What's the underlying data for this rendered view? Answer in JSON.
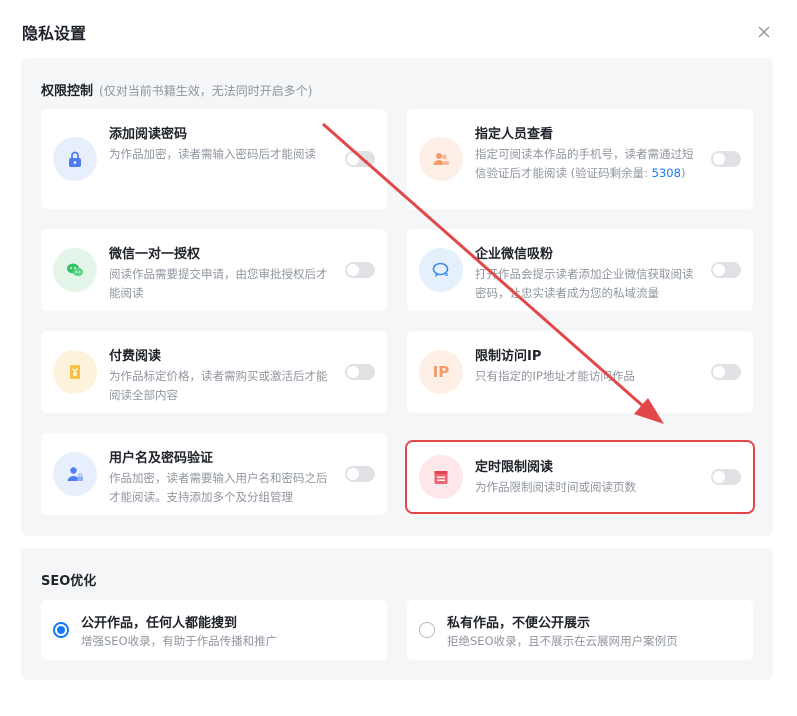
{
  "dialog": {
    "title": "隐私设置",
    "close_icon": "close-icon"
  },
  "permissions": {
    "title": "权限控制",
    "note": "(仅对当前书籍生效，无法同时开启多个)",
    "items": [
      {
        "title": "添加阅读密码",
        "desc": "为作品加密，读者需输入密码后才能阅读",
        "icon": "lock-icon",
        "enabled": false
      },
      {
        "title": "指定人员查看",
        "desc_before": "指定可阅读本作品的手机号，读者需通过短信验证后才能阅读 (验证码剩余量: ",
        "desc_count": "5308",
        "desc_after": ")",
        "icon": "people-icon",
        "enabled": false
      },
      {
        "title": "微信一对一授权",
        "desc": "阅读作品需要提交申请，由您审批授权后才能阅读",
        "icon": "wechat-icon",
        "enabled": false
      },
      {
        "title": "企业微信吸粉",
        "desc": "打开作品会提示读者添加企业微信获取阅读密码，让忠实读者成为您的私域流量",
        "icon": "wework-icon",
        "enabled": false
      },
      {
        "title": "付费阅读",
        "desc": "为作品标定价格，读者需购买或激活后才能阅读全部内容",
        "icon": "yen-book-icon",
        "enabled": false
      },
      {
        "title": "限制访问IP",
        "desc": "只有指定的IP地址才能访问作品",
        "icon": "ip-icon",
        "icon_text": "IP",
        "enabled": false
      },
      {
        "title": "用户名及密码验证",
        "desc": "作品加密，读者需要输入用户名和密码之后才能阅读。支持添加多个及分组管理",
        "icon": "user-lock-icon",
        "enabled": false
      },
      {
        "title": "定时限制阅读",
        "desc": "为作品限制阅读时间或阅读页数",
        "icon": "calendar-icon",
        "enabled": false
      }
    ]
  },
  "seo": {
    "title": "SEO优化",
    "options": [
      {
        "title": "公开作品，任何人都能搜到",
        "desc": "增强SEO收录，有助于作品传播和推广",
        "selected": true
      },
      {
        "title": "私有作品，不便公开展示",
        "desc": "拒绝SEO收录，且不展示在云展网用户案例页",
        "selected": false
      }
    ]
  },
  "colors": {
    "accent": "#1677ff",
    "annotation": "#e34848"
  }
}
